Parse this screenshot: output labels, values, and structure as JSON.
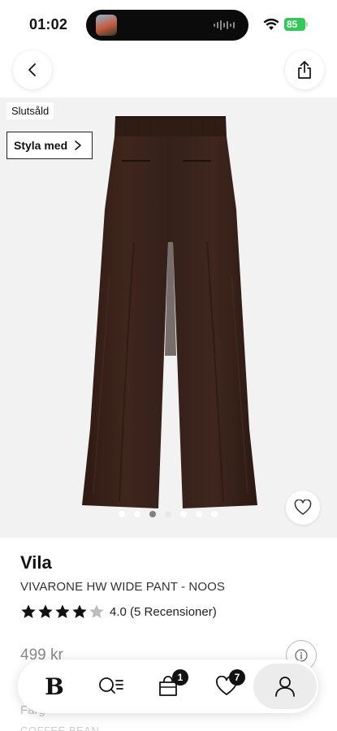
{
  "status_bar": {
    "time": "01:02",
    "battery": "85"
  },
  "nav": {
    "back_icon": "chevron-left-icon",
    "share_icon": "share-icon"
  },
  "gallery": {
    "sold_out_label": "Slutsåld",
    "style_with_label": "Styla med",
    "image_count": 7,
    "active_index": 2,
    "product_color": "#3b241c"
  },
  "product": {
    "brand": "Vila",
    "name": "VIVARONE HW WIDE PANT - NOOS",
    "rating_value": 4,
    "rating_max": 5,
    "rating_text": "4.0 (5 Recensioner)",
    "price": "499 kr",
    "color_label": "Färg",
    "color_value": "COFFEE BEAN"
  },
  "tab_bar": {
    "home_logo": "B",
    "bag_count": "1",
    "favorites_count": "7",
    "active_tab": "account"
  },
  "colors": {
    "accent": "#111111",
    "battery": "#34c759",
    "image_bg": "#f2f2f2"
  }
}
